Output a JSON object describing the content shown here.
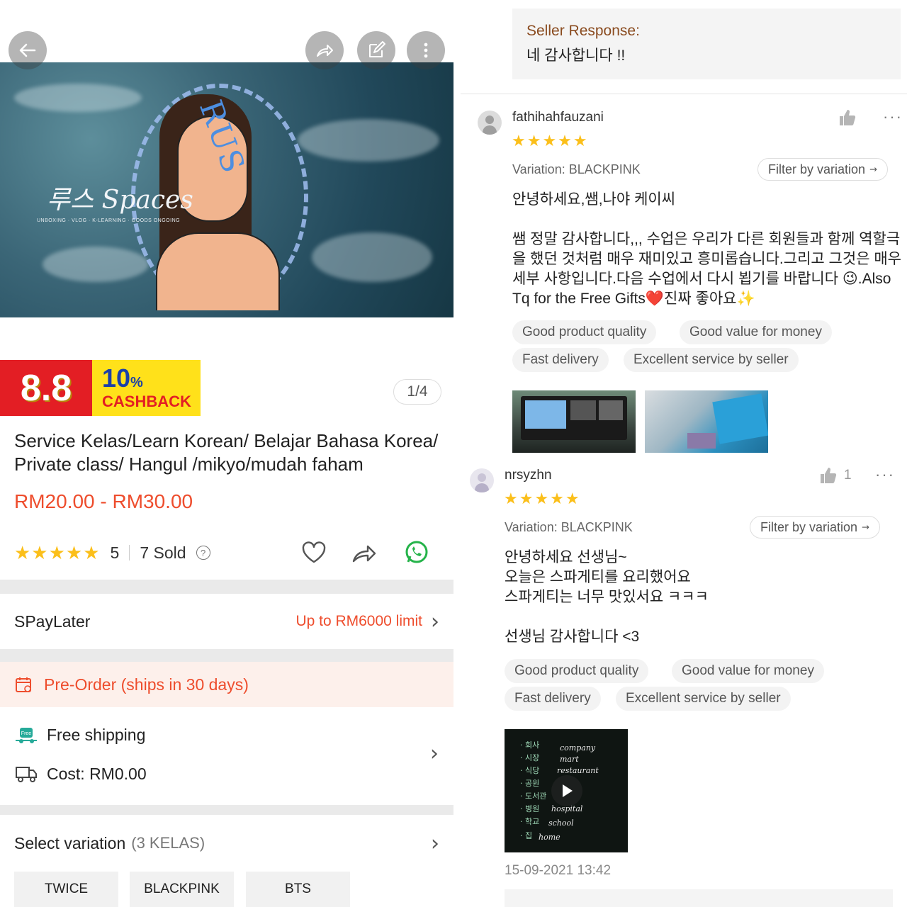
{
  "product": {
    "image_counter": "1/4",
    "hero_brand": "루스 Spaces",
    "hero_subtitle": "UNBOXING · VLOG · K-LEARNING · GOODS ONGOING",
    "promo_88": "8.8",
    "promo_percent": "10",
    "promo_percent_sign": "%",
    "promo_cashback": "CASHBACK",
    "title": "Service  Kelas/Learn Korean/ Belajar Bahasa Korea/ Private class/ Hangul /mikyo/mudah faham",
    "price": "RM20.00 - RM30.00",
    "rating_stars": "★★★★★",
    "rating_value": "5",
    "sold": "7 Sold",
    "help_glyph": "?",
    "spaylater_label": "SPayLater",
    "spaylater_value": "Up to RM6000 limit",
    "preorder": "Pre-Order (ships in 30 days)",
    "free_shipping": "Free shipping",
    "free_badge": "Free",
    "shipping_cost": "Cost: RM0.00",
    "variation_label": "Select variation",
    "variation_count": "(3 KELAS)",
    "variations": [
      "TWICE",
      "BLACKPINK",
      "BTS"
    ]
  },
  "reviews": {
    "seller_response_heading": "Seller Response:",
    "seller_response_text": "네 감사합니다 !!",
    "filter_label": "Filter by variation",
    "items": [
      {
        "username": "fathihahfauzani",
        "stars": "★★★★★",
        "variation": "Variation: BLACKPINK",
        "like_count": "",
        "text": "안녕하세요,쌤,나야 케이씨\n\n쌤 정말 감사합니다,,, 수업은 우리가 다른 회원들과 함께 역할극을 했던 것처럼 매우 재미있고 흥미롭습니다.그리고 그것은 매우 세부 사항입니다.다음 수업에서 다시 뵙기를 바랍니다 😉.Also Tq for the Free Gifts❤️진짜 좋아요✨",
        "tags": [
          "Good product quality",
          "Good value for money",
          "Fast delivery",
          "Excellent service by seller"
        ]
      },
      {
        "username": "nrsyzhn",
        "stars": "★★★★★",
        "variation": "Variation: BLACKPINK",
        "like_count": "1",
        "text": "안녕하세요 선생님~\n오늘은 스파게티를 요리했어요\n스파게티는 너무 맛있서요 ㅋㅋㅋ\n\n선생님 감사합니다 <3",
        "tags": [
          "Good product quality",
          "Good value for money",
          "Fast delivery",
          "Excellent service by seller"
        ],
        "date": "15-09-2021 13:42",
        "video_words": [
          "company",
          "mart",
          "restaurant",
          "hospital",
          "school",
          "home"
        ]
      }
    ]
  },
  "colors": {
    "accent": "#ee4d2d",
    "star": "#fbbf1a",
    "seller_heading": "#8a4b1f",
    "promo_red": "#e31e24",
    "promo_yellow": "#ffe11a"
  }
}
